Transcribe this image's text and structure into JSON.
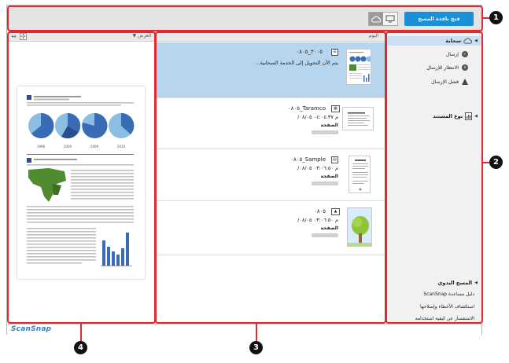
{
  "toolbar": {
    "scan_button": "فتح نافذة المسح"
  },
  "preview_pane": {
    "header_label": "العرض",
    "chart_years": [
      "1998",
      "2000",
      "2009",
      "2010"
    ]
  },
  "list_pane": {
    "header_label": "اليوم",
    "rows": [
      {
        "name": "٣٠٠٥_٠٨٠٥",
        "status": "يتم الآن التحويل إلى الخدمة السحابية...",
        "meta": "",
        "pages": "",
        "selected": true
      },
      {
        "name": "Taramco_٠٨٠٥",
        "status": "",
        "meta": "م ٠٤:٠٤:٣٧ ٠٨/٠٥/",
        "pages": "الصفحة",
        "selected": false
      },
      {
        "name": "Sample_٠٨٠٥",
        "status": "",
        "meta": "م ٠٣:٠٦:٥٠ ٠٨/٠٥/",
        "pages": "الصفحة",
        "selected": false
      },
      {
        "name": "٠٨٠٥",
        "status": "",
        "meta": "م ٠٣:٠٦:٥٠ ٠٨/٠٥/",
        "pages": "الصفحة",
        "selected": false
      }
    ]
  },
  "nav_pane": {
    "cloud_label": "سحابة",
    "status_items": [
      {
        "label": "إرسال",
        "icon": "check-icon"
      },
      {
        "label": "الانتظار للإرسال",
        "icon": "pause-icon"
      },
      {
        "label": "فشل الإرسال",
        "icon": "warning-icon"
      }
    ],
    "doc_type_label": "نوع المستند",
    "manual_label": "المسح اليدوي",
    "links": [
      "دليل مساعدة ScanSnap",
      "استكشاف الأخطاء وإصلاحها",
      "الاستفسار عن كيفية استخدامه"
    ]
  },
  "brand": {
    "logo_text": "ScanSnap"
  },
  "callouts": [
    "1",
    "2",
    "3",
    "4"
  ],
  "colors": {
    "accent": "#1b8fd8",
    "callout": "#e0282f",
    "selection": "#b7d6ee"
  }
}
